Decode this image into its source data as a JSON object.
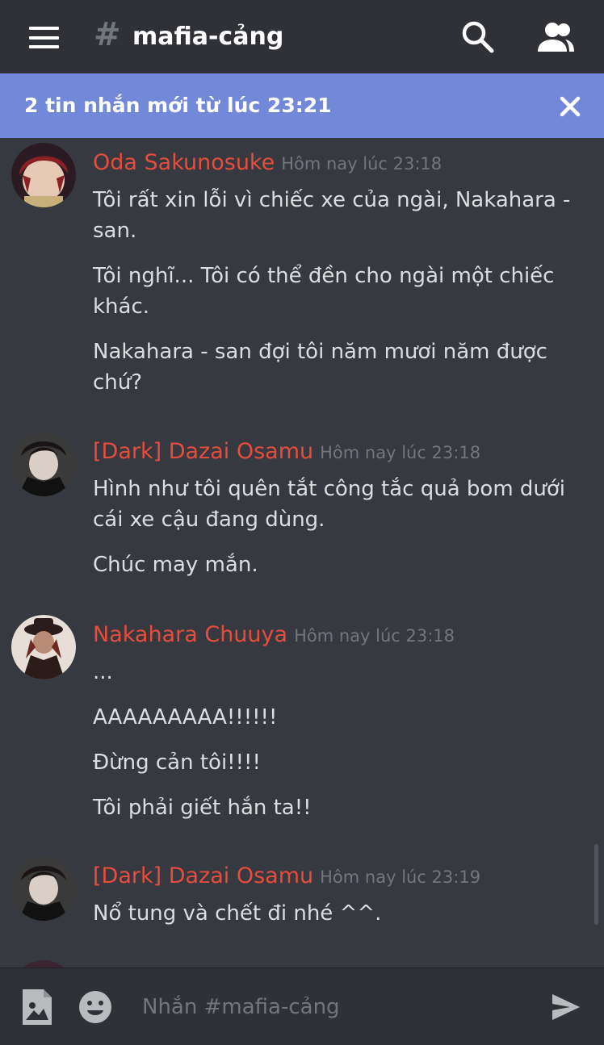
{
  "header": {
    "channel_name": "mafia-cảng",
    "hash_symbol": "#"
  },
  "banner": {
    "text": "2 tin nhắn mới từ lúc 23:21"
  },
  "messages": [
    {
      "author": "Oda Sakunosuke",
      "timestamp": "Hôm nay lúc 23:18",
      "lines": [
        "Tôi rất xin lỗi vì chiếc xe của ngài, Nakahara - san.",
        "Tôi nghĩ... Tôi có thể đền cho ngài một chiếc khác.",
        "Nakahara - san đợi tôi năm mươi năm được chứ?"
      ]
    },
    {
      "author": "[Dark] Dazai Osamu",
      "timestamp": "Hôm nay lúc 23:18",
      "lines": [
        "Hình như tôi quên tắt công tắc quả bom dưới cái xe cậu đang dùng.",
        "Chúc may mắn."
      ]
    },
    {
      "author": "Nakahara Chuuya",
      "timestamp": "Hôm nay lúc 23:18",
      "lines": [
        "...",
        "AAAAAAAAA!!!!!!",
        "Đừng cản tôi!!!!",
        "Tôi phải giết hắn ta!!"
      ]
    },
    {
      "author": "[Dark] Dazai Osamu",
      "timestamp": "Hôm nay lúc 23:19",
      "lines": [
        "Nổ tung và chết đi nhé ^^."
      ]
    }
  ],
  "composer": {
    "placeholder": "Nhắn #mafia-cảng",
    "value": ""
  },
  "colors": {
    "background": "#36393f",
    "header": "#2f3136",
    "banner": "#7289da",
    "author": "#e74c3c",
    "timestamp": "#72767d",
    "text": "#dcddde"
  },
  "icons": {
    "menu": "hamburger-menu-icon",
    "search": "search-icon",
    "members": "members-icon",
    "close": "close-icon",
    "attach": "image-attach-icon",
    "emoji": "emoji-icon",
    "send": "send-icon"
  }
}
